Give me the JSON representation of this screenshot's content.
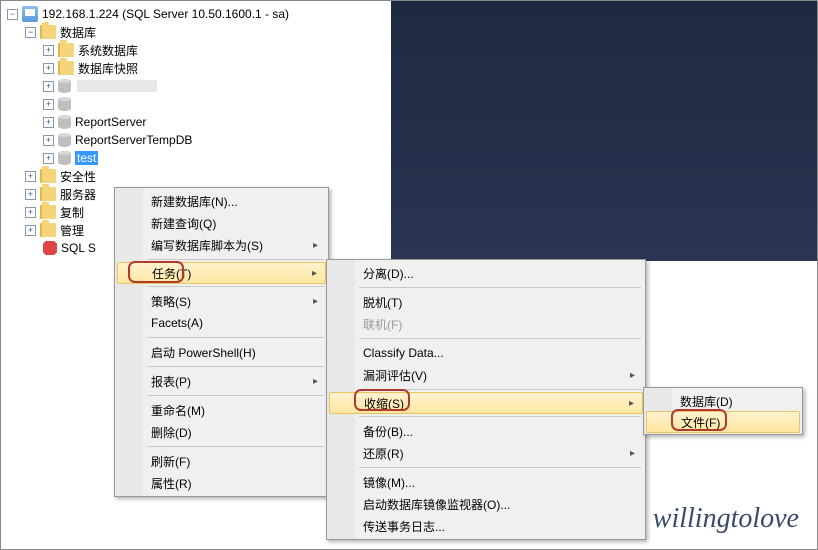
{
  "server": {
    "title": "192.168.1.224 (SQL Server 10.50.1600.1 - sa)"
  },
  "tree": {
    "databases": "数据库",
    "sysdb": "系统数据库",
    "snapshot": "数据库快照",
    "rs": "ReportServer",
    "rst": "ReportServerTempDB",
    "test": "test",
    "security": "安全性",
    "servers": "服务器",
    "replication": "复制",
    "management": "管理",
    "sqls": "SQL S"
  },
  "m1": {
    "newdb": "新建数据库(N)...",
    "newquery": "新建查询(Q)",
    "script": "编写数据库脚本为(S)",
    "tasks": "任务(T)",
    "policies": "策略(S)",
    "facets": "Facets(A)",
    "powershell": "启动 PowerShell(H)",
    "reports": "报表(P)",
    "rename": "重命名(M)",
    "delete": "删除(D)",
    "refresh": "刷新(F)",
    "properties": "属性(R)"
  },
  "m2": {
    "detach": "分离(D)...",
    "offline": "脱机(T)",
    "online": "联机(F)",
    "classify": "Classify Data...",
    "vuln": "漏洞评估(V)",
    "shrink": "收缩(S)",
    "backup": "备份(B)...",
    "restore": "还原(R)",
    "mirror": "镜像(M)...",
    "monitor": "启动数据库镜像监视器(O)...",
    "shiplog": "传送事务日志..."
  },
  "m3": {
    "database": "数据库(D)",
    "file": "文件(F)"
  },
  "watermark": "willingtolove"
}
